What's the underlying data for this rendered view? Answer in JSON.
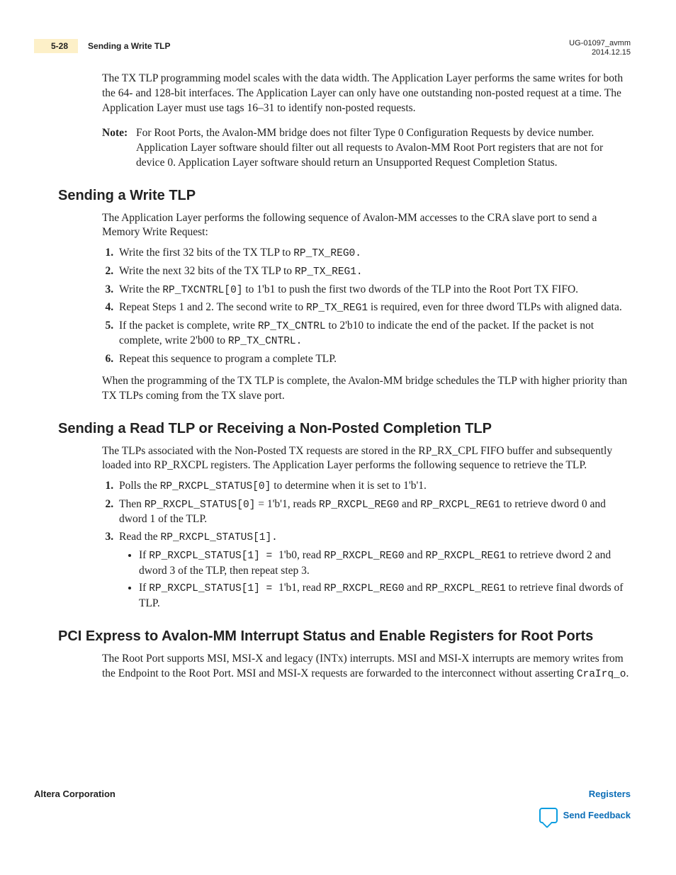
{
  "header": {
    "page_number": "5-28",
    "topic": "Sending a Write TLP",
    "doc_id": "UG-01097_avmm",
    "date": "2014.12.15"
  },
  "intro_para": "The TX TLP programming model scales with the data width. The Application Layer performs the same writes for both the 64- and 128-bit interfaces. The Application Layer can only have one outstanding non-posted request at a time. The Application Layer must use tags 16–31 to identify non-posted requests.",
  "note": {
    "label": "Note:",
    "text": "For Root Ports, the Avalon-MM bridge does not filter Type 0 Configuration Requests by device number. Application Layer software should filter out all requests to Avalon-MM Root Port registers that are not for device 0. Application Layer software should return an Unsupported Request Completion Status."
  },
  "sec1": {
    "title": "Sending a Write TLP",
    "intro": "The Application Layer performs the following sequence of Avalon-MM accesses to the CRA slave port to send a Memory Write Request:",
    "steps": {
      "s1a": "Write the first 32 bits of the TX TLP to ",
      "s1b": "RP_TX_REG0.",
      "s2a": "Write the next 32 bits of the TX TLP to ",
      "s2b": "RP_TX_REG1.",
      "s3a": "Write the ",
      "s3b": "RP_TXCNTRL[0]",
      "s3c": " to 1'b1 to push the first two dwords of the TLP into the Root Port TX FIFO.",
      "s4a": "Repeat Steps 1 and 2. The second write to ",
      "s4b": "RP_TX_REG1",
      "s4c": " is required, even for three dword TLPs with aligned data.",
      "s5a": "If the packet is complete, write ",
      "s5b": "RP_TX_CNTRL",
      "s5c": " to 2'b10 to indicate the end of the packet. If the packet is not complete, write 2'b00 to ",
      "s5d": "RP_TX_CNTRL.",
      "s6": "Repeat this sequence to program a complete TLP."
    },
    "outro": "When the programming of the TX TLP is complete, the Avalon‑MM bridge schedules the TLP with higher priority than TX TLPs coming from the TX slave port."
  },
  "sec2": {
    "title": "Sending a Read TLP or Receiving a Non-Posted Completion TLP",
    "intro": "The TLPs associated with the Non-Posted TX requests are stored in the RP_RX_CPL FIFO buffer and subsequently loaded into RP_RXCPL registers. The Application Layer performs the following sequence to retrieve the TLP.",
    "steps": {
      "s1a": "Polls the ",
      "s1b": "RP_RXCPL_STATUS[0]",
      "s1c": " to determine when it is set to 1'b'1.",
      "s2a": "Then ",
      "s2b": "RP_RXCPL_STATUS[0]",
      "s2c": " = 1'b'1, reads ",
      "s2d": "RP_RXCPL_REG0",
      "s2e": " and ",
      "s2f": "RP_RXCPL_REG1",
      "s2g": " to retrieve dword 0 and dword 1 of the TLP.",
      "s3a": "Read the ",
      "s3b": "RP_RXCPL_STATUS[1].",
      "b1a": "If ",
      "b1b": "RP_RXCPL_STATUS[1] = ",
      "b1c": "1'b0, read ",
      "b1d": "RP_RXCPL_REG0",
      "b1e": " and ",
      "b1f": "RP_RXCPL_REG1",
      "b1g": " to retrieve dword 2 and dword 3 of the TLP, then repeat step 3.",
      "b2a": "If ",
      "b2b": "RP_RXCPL_STATUS[1] = ",
      "b2c": "1'b1, read ",
      "b2d": "RP_RXCPL_REG0",
      "b2e": " and ",
      "b2f": "RP_RXCPL_REG1",
      "b2g": " to retrieve final dwords of TLP."
    }
  },
  "sec3": {
    "title": "PCI Express to Avalon-MM Interrupt Status and Enable Registers for Root Ports",
    "para_a": "The Root Port supports MSI, MSI‑X and legacy (INTx) interrupts. MSI and MSI‑X interrupts are memory writes from the Endpoint to the Root Port. MSI and MSI‑X requests are forwarded to the interconnect without asserting ",
    "para_b": "CraIrq_o",
    "para_c": "."
  },
  "footer": {
    "left": "Altera Corporation",
    "right_top": "Registers",
    "right_bottom": "Send Feedback"
  }
}
